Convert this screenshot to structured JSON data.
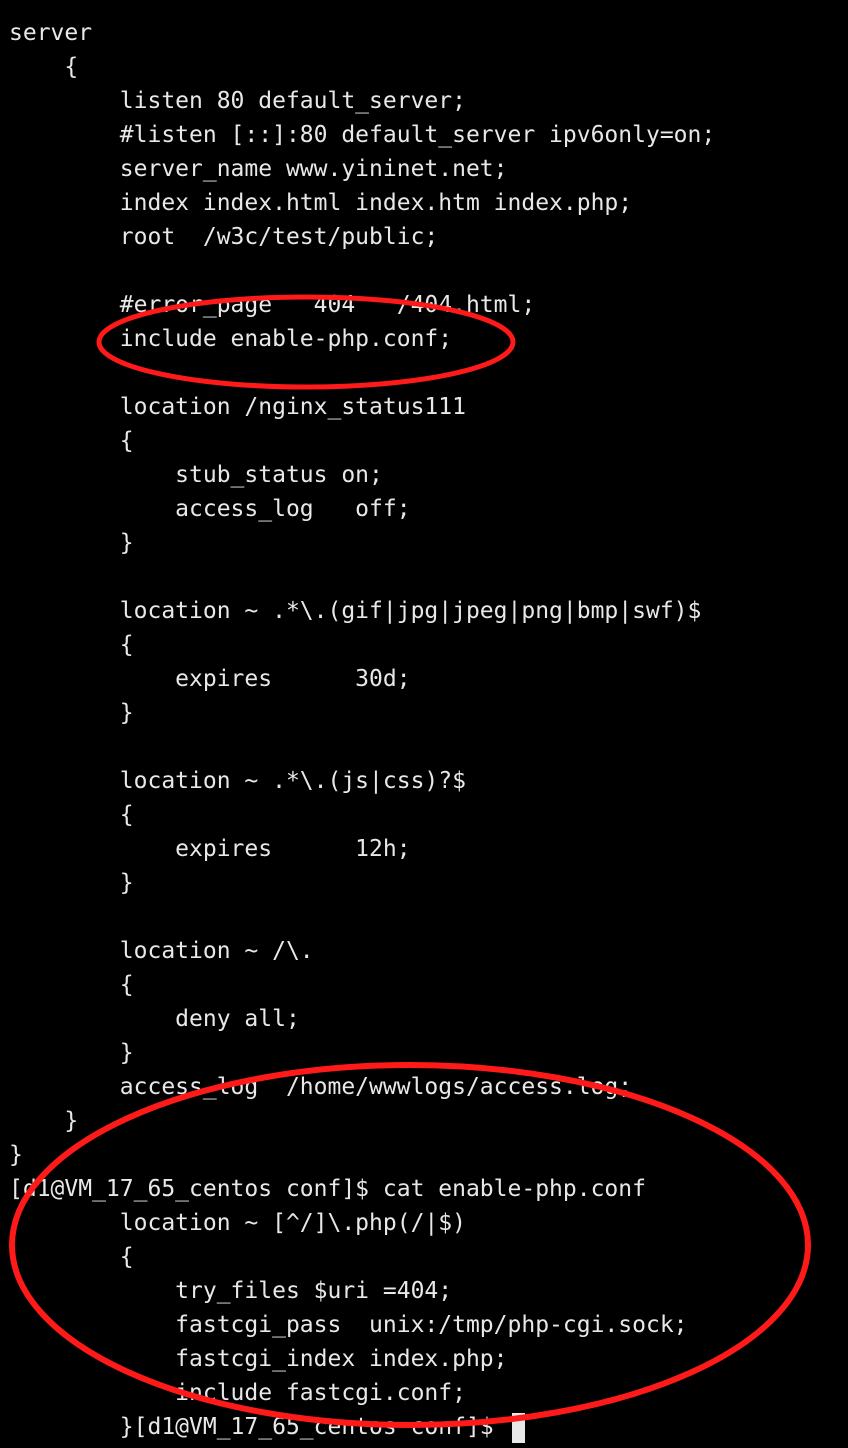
{
  "terminal": {
    "lines": [
      "server",
      "    {",
      "        listen 80 default_server;",
      "        #listen [::]:80 default_server ipv6only=on;",
      "        server_name www.yininet.net;",
      "        index index.html index.htm index.php;",
      "        root  /w3c/test/public;",
      "",
      "        #error_page   404   /404.html;",
      "        include enable-php.conf;",
      "",
      "        location /nginx_status111",
      "        {",
      "            stub_status on;",
      "            access_log   off;",
      "        }",
      "",
      "        location ~ .*\\.(gif|jpg|jpeg|png|bmp|swf)$",
      "        {",
      "            expires      30d;",
      "        }",
      "",
      "        location ~ .*\\.(js|css)?$",
      "        {",
      "            expires      12h;",
      "        }",
      "",
      "        location ~ /\\.",
      "        {",
      "            deny all;",
      "        }",
      "        access_log  /home/wwwlogs/access.log;",
      "    }",
      "}",
      "[d1@VM_17_65_centos conf]$ cat enable-php.conf",
      "        location ~ [^/]\\.php(/|$)",
      "        {",
      "            try_files $uri =404;",
      "            fastcgi_pass  unix:/tmp/php-cgi.sock;",
      "            fastcgi_index index.php;",
      "            include fastcgi.conf;",
      "        }[d1@VM_17_65_centos conf]$ "
    ]
  },
  "colors": {
    "background": "#000000",
    "text": "#e8e8e8",
    "annotation": "#ff1a1a"
  }
}
